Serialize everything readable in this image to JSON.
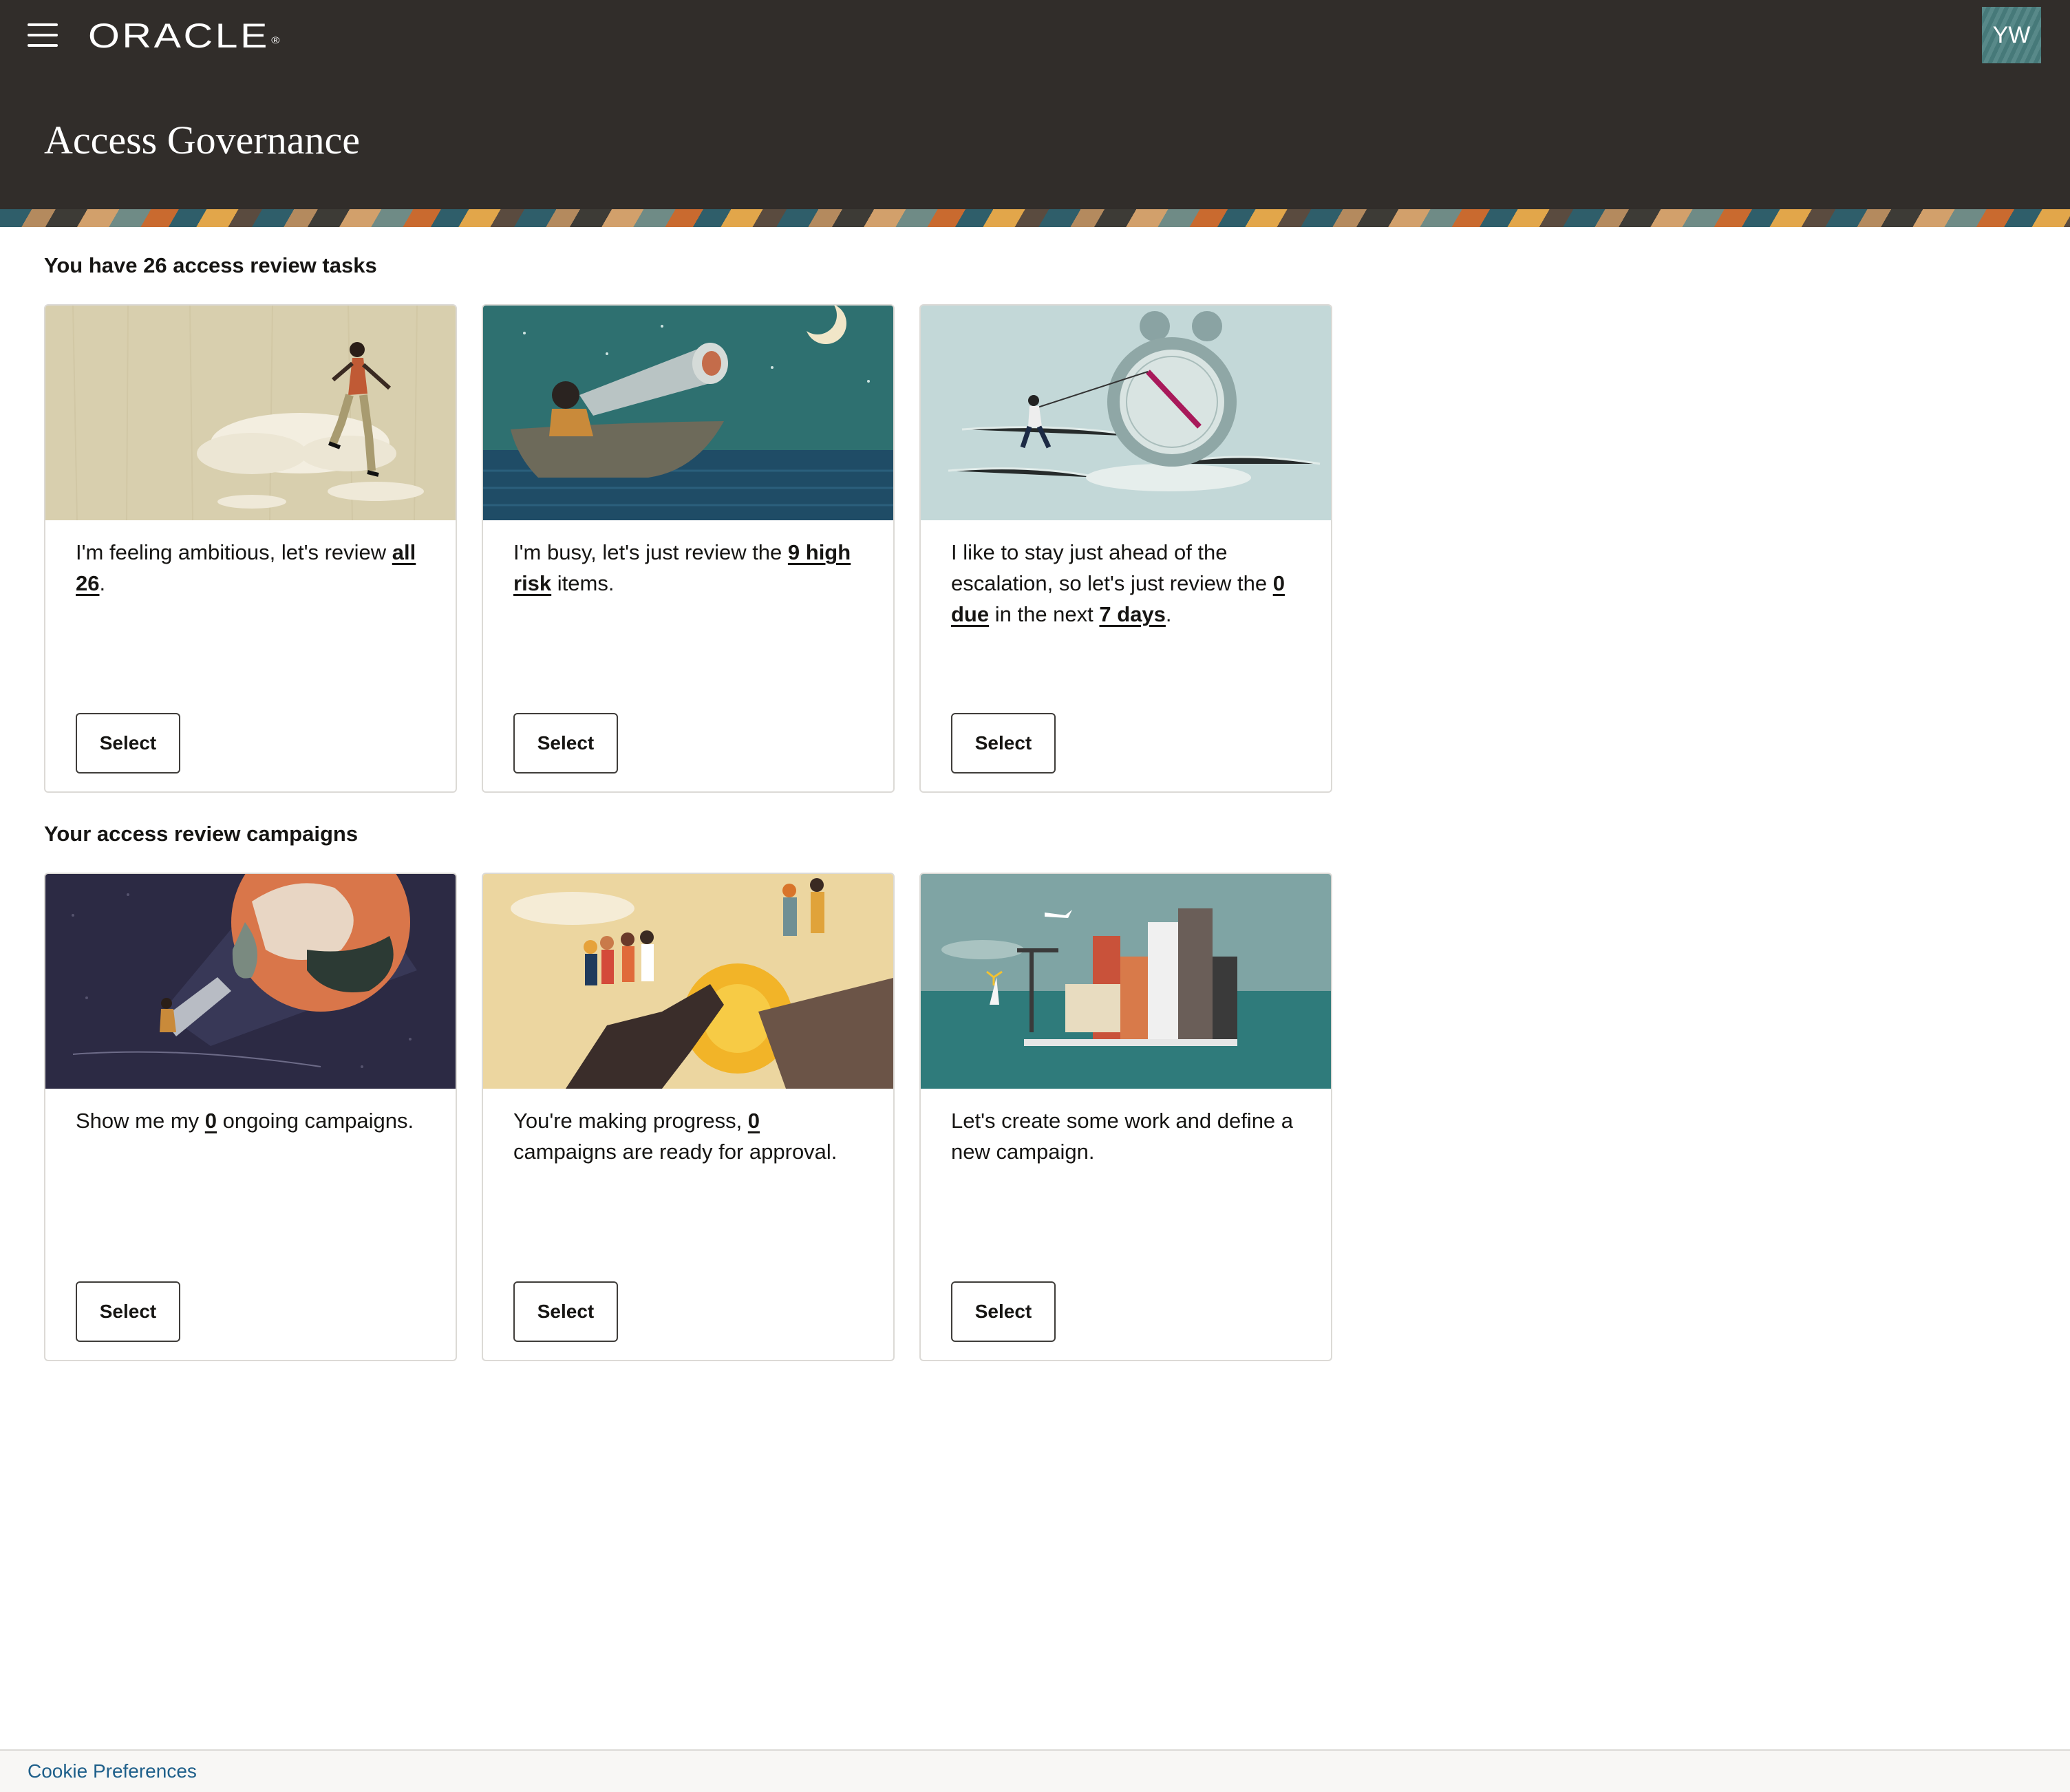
{
  "header": {
    "logo_text": "ORACLE",
    "logo_mark": "®",
    "avatar_initials": "YW",
    "menu_icon": "hamburger-menu-icon"
  },
  "page": {
    "title": "Access Governance"
  },
  "tasks_section": {
    "heading": "You have 26 access review tasks",
    "cards": [
      {
        "text_before": "I'm feeling ambitious, let's review ",
        "link1": "all 26",
        "text_after": ".",
        "button": "Select",
        "illustration": "person-stepping-on-clouds"
      },
      {
        "text_before": "I'm busy, let's just review the ",
        "link1": "9 high risk",
        "text_after": " items.",
        "button": "Select",
        "illustration": "person-with-telescope-in-boat"
      },
      {
        "text_before": "I like to stay just ahead of the escalation, so let's just review the ",
        "link1": "0 due",
        "text_middle": " in the next ",
        "link2": "7 days",
        "text_after": ".",
        "button": "Select",
        "illustration": "person-pulling-clock-hand"
      }
    ]
  },
  "campaigns_section": {
    "heading": "Your access review campaigns",
    "cards": [
      {
        "text_before": "Show me my ",
        "link1": "0",
        "text_after": " ongoing campaigns.",
        "button": "Select",
        "illustration": "person-with-flashlight"
      },
      {
        "text_before": "You're making progress, ",
        "link1": "0",
        "text_after": " campaigns are ready for approval.",
        "button": "Select",
        "illustration": "people-on-cliff-with-sun"
      },
      {
        "text_before": "Let's create some work and define a new campaign.",
        "button": "Select",
        "illustration": "city-skyline-on-water"
      }
    ]
  },
  "footer": {
    "cookie_link": "Cookie Preferences"
  },
  "colors": {
    "header_bg": "#312d2a",
    "link_blue": "#1e5f8a",
    "avatar_bg": "#4a7f7f"
  }
}
